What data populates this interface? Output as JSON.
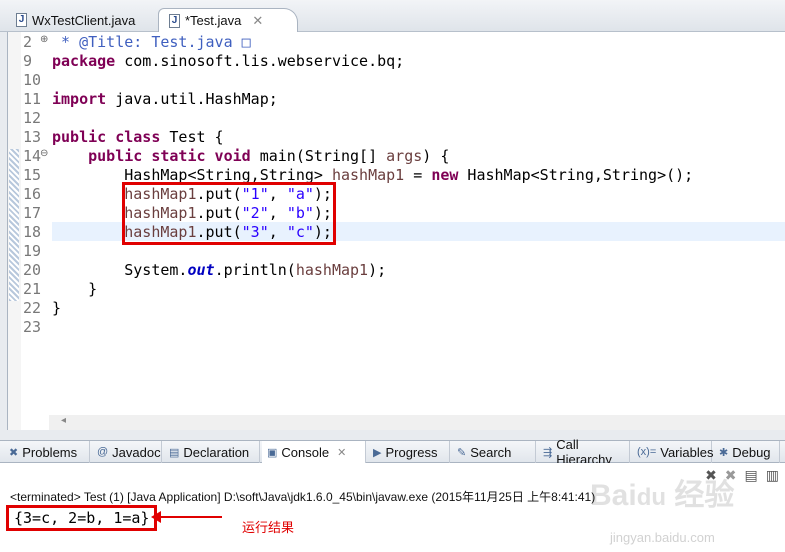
{
  "editor_tabs": [
    {
      "label": "WxTestClient.java",
      "active": false
    },
    {
      "label": "*Test.java",
      "active": true
    }
  ],
  "code_lines": [
    {
      "num": "2",
      "tokens": [
        {
          "k": "cm",
          "t": " * @Title: Test.java "
        },
        {
          "k": "cm",
          "t": "□"
        }
      ]
    },
    {
      "num": "9",
      "tokens": [
        {
          "k": "kw",
          "t": "package"
        },
        {
          "k": "",
          "t": " com.sinosoft.lis.webservice.bq;"
        }
      ]
    },
    {
      "num": "10",
      "tokens": []
    },
    {
      "num": "11",
      "tokens": [
        {
          "k": "kw",
          "t": "import"
        },
        {
          "k": "",
          "t": " java.util.HashMap;"
        }
      ]
    },
    {
      "num": "12",
      "tokens": []
    },
    {
      "num": "13",
      "tokens": [
        {
          "k": "kw",
          "t": "public class"
        },
        {
          "k": "",
          "t": " Test {"
        }
      ]
    },
    {
      "num": "14",
      "tokens": [
        {
          "k": "",
          "t": "    "
        },
        {
          "k": "kw",
          "t": "public static void"
        },
        {
          "k": "",
          "t": " main(String[] "
        },
        {
          "k": "var",
          "t": "args"
        },
        {
          "k": "",
          "t": ") {"
        }
      ]
    },
    {
      "num": "15",
      "tokens": [
        {
          "k": "",
          "t": "        HashMap<String,String> "
        },
        {
          "k": "var",
          "t": "hashMap1"
        },
        {
          "k": "",
          "t": " = "
        },
        {
          "k": "kw",
          "t": "new"
        },
        {
          "k": "",
          "t": " HashMap<String,String>();"
        }
      ]
    },
    {
      "num": "16",
      "tokens": [
        {
          "k": "",
          "t": "        "
        },
        {
          "k": "var",
          "t": "hashMap1"
        },
        {
          "k": "",
          "t": ".put("
        },
        {
          "k": "str",
          "t": "\"1\""
        },
        {
          "k": "",
          "t": ", "
        },
        {
          "k": "str",
          "t": "\"a\""
        },
        {
          "k": "",
          "t": ");"
        }
      ]
    },
    {
      "num": "17",
      "tokens": [
        {
          "k": "",
          "t": "        "
        },
        {
          "k": "var",
          "t": "hashMap1"
        },
        {
          "k": "",
          "t": ".put("
        },
        {
          "k": "str",
          "t": "\"2\""
        },
        {
          "k": "",
          "t": ", "
        },
        {
          "k": "str",
          "t": "\"b\""
        },
        {
          "k": "",
          "t": ");"
        }
      ]
    },
    {
      "num": "18",
      "tokens": [
        {
          "k": "",
          "t": "        "
        },
        {
          "k": "var",
          "t": "hashMap1"
        },
        {
          "k": "",
          "t": ".put("
        },
        {
          "k": "str",
          "t": "\"3\""
        },
        {
          "k": "",
          "t": ", "
        },
        {
          "k": "str",
          "t": "\"c\""
        },
        {
          "k": "",
          "t": ");"
        }
      ]
    },
    {
      "num": "19",
      "tokens": []
    },
    {
      "num": "20",
      "tokens": [
        {
          "k": "",
          "t": "        System."
        },
        {
          "k": "fld",
          "t": "out"
        },
        {
          "k": "",
          "t": ".println("
        },
        {
          "k": "var",
          "t": "hashMap1"
        },
        {
          "k": "",
          "t": ");"
        }
      ]
    },
    {
      "num": "21",
      "tokens": [
        {
          "k": "",
          "t": "    }"
        }
      ]
    },
    {
      "num": "22",
      "tokens": [
        {
          "k": "",
          "t": "}"
        }
      ]
    },
    {
      "num": "23",
      "tokens": []
    }
  ],
  "panel_tabs": [
    {
      "label": "Problems",
      "icon": "problems-icon",
      "glyph": "✖"
    },
    {
      "label": "Javadoc",
      "icon": "at-icon",
      "glyph": "@"
    },
    {
      "label": "Declaration",
      "icon": "declaration-icon",
      "glyph": "▤"
    },
    {
      "label": "Console",
      "icon": "console-icon",
      "glyph": "▣",
      "active": true
    },
    {
      "label": "Progress",
      "icon": "progress-icon",
      "glyph": "▶"
    },
    {
      "label": "Search",
      "icon": "search-icon",
      "glyph": "✎"
    },
    {
      "label": "Call Hierarchy",
      "icon": "call-hierarchy-icon",
      "glyph": "⇶"
    },
    {
      "label": "Variables",
      "icon": "variables-icon",
      "glyph": "(x)="
    },
    {
      "label": "Debug",
      "icon": "debug-icon",
      "glyph": "✱"
    }
  ],
  "console": {
    "status": "<terminated> Test (1) [Java Application] D:\\soft\\Java\\jdk1.6.0_45\\bin\\javaw.exe (2015年11月25日 上午8:41:41)",
    "output": "{3=c, 2=b, 1=a}"
  },
  "annotation": "运行结果",
  "watermark": {
    "logo": "Baidu 经验",
    "url": "jingyan.baidu.com"
  },
  "colors": {
    "highlight": "#e00000",
    "keyword": "#7f0055",
    "string": "#2a00ff"
  }
}
